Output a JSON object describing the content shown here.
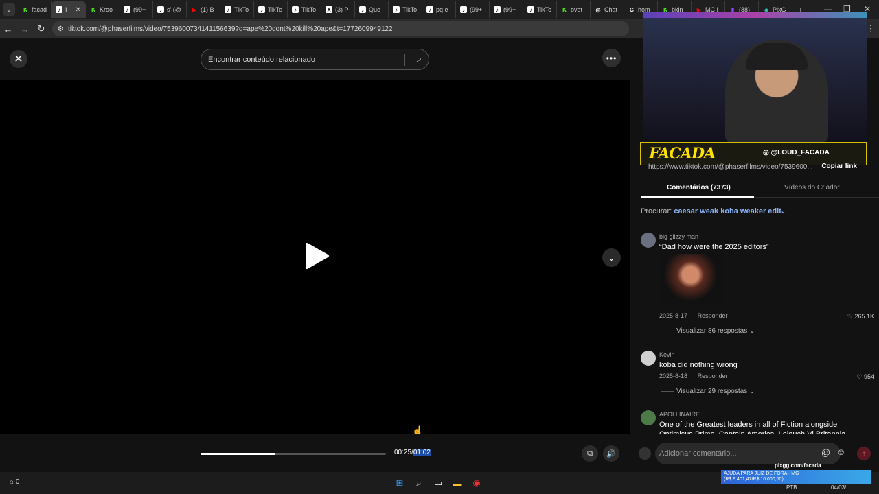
{
  "browser": {
    "tabs": [
      {
        "label": "facad",
        "fav": "K",
        "color": "#53fc18",
        "active": false
      },
      {
        "label": "I",
        "fav": "♪",
        "color": "#000000",
        "active": true
      },
      {
        "label": "Kroo",
        "fav": "K",
        "color": "#53fc18",
        "active": false
      },
      {
        "label": "(99+",
        "fav": "♪",
        "color": "#000000",
        "active": false
      },
      {
        "label": "s' (@",
        "fav": "♪",
        "color": "#000000",
        "active": false
      },
      {
        "label": "(1) B",
        "fav": "▶",
        "color": "#ff0000",
        "active": false
      },
      {
        "label": "TikTo",
        "fav": "♪",
        "color": "#000000",
        "active": false
      },
      {
        "label": "TikTo",
        "fav": "♪",
        "color": "#000000",
        "active": false
      },
      {
        "label": "TikTo",
        "fav": "♪",
        "color": "#000000",
        "active": false
      },
      {
        "label": "(3) P",
        "fav": "X",
        "color": "#000000",
        "active": false
      },
      {
        "label": "Que",
        "fav": "♪",
        "color": "#000000",
        "active": false
      },
      {
        "label": "TikTo",
        "fav": "♪",
        "color": "#000000",
        "active": false
      },
      {
        "label": "pq e",
        "fav": "♪",
        "color": "#000000",
        "active": false
      },
      {
        "label": "(99+",
        "fav": "♪",
        "color": "#000000",
        "active": false
      },
      {
        "label": "(99+",
        "fav": "♪",
        "color": "#000000",
        "active": false
      },
      {
        "label": "TikTo",
        "fav": "♪",
        "color": "#000000",
        "active": false
      },
      {
        "label": "ovot",
        "fav": "K",
        "color": "#53fc18",
        "active": false
      },
      {
        "label": "Chat",
        "fav": "◎",
        "color": "#ffffff",
        "active": false
      },
      {
        "label": "hom",
        "fav": "G",
        "color": "#ffffff",
        "active": false
      },
      {
        "label": "bkin",
        "fav": "K",
        "color": "#53fc18",
        "active": false
      },
      {
        "label": "MC I",
        "fav": "▶",
        "color": "#ff0000",
        "active": false
      },
      {
        "label": "(88)",
        "fav": "▮",
        "color": "#9146ff",
        "active": false
      },
      {
        "label": "PixG",
        "fav": "◆",
        "color": "#32bcad",
        "active": false
      }
    ],
    "url": "tiktok.com/@phaserfilms/video/7539600734141156639?q=ape%20dont%20kill%20ape&t=1772609949122"
  },
  "player": {
    "search_placeholder": "Encontrar conteúdo relacionado",
    "time_current": "00:25",
    "time_total": "01:02",
    "progress_fraction": 0.4032
  },
  "stream_overlay": {
    "brand": "FACADA",
    "handle": "◎ @LOUD_FACADA"
  },
  "share": {
    "link": "https://www.tiktok.com/@phaserfilms/video/7539600...",
    "copy_label": "Copiar link"
  },
  "tabs": {
    "comments": "Comentários (7373)",
    "creator_videos": "Vídeos do Criador"
  },
  "search_suggestion": {
    "label": "Procurar:",
    "query": "caesar weak koba weaker edit"
  },
  "comments": [
    {
      "name": "big glizzy man",
      "text": "“Dad how were the 2025 editors”",
      "date": "2025-8-17",
      "reply": "Responder",
      "likes": "265.1K",
      "replies": "Visualizar 86 respostas"
    },
    {
      "name": "Kevin",
      "text": "koba did nothing wrong",
      "date": "2025-8-18",
      "reply": "Responder",
      "likes": "954",
      "replies": "Visualizar 29 respostas"
    },
    {
      "name": "APOLLINAIRE",
      "text": "One of the Greatest leaders in all of Fiction alongside Optimisus Prime, Captain America, Lelouch Vi Britannia"
    }
  ],
  "comment_input": {
    "placeholder": "Adicionar comentário..."
  },
  "taskbar": {
    "left_count": "0",
    "pix_url": "pixgg.com/facada",
    "donation_title": "AJUDA PARA JUIZ DE FORA - MG",
    "donation_amount": "(R$ 9.401,47/R$ 10.000,00)",
    "lang": "PTB",
    "date": "04/03/"
  }
}
